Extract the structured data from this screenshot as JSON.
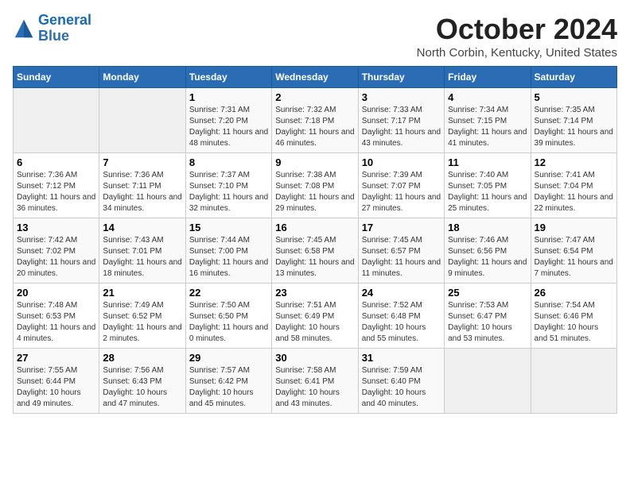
{
  "logo": {
    "line1": "General",
    "line2": "Blue"
  },
  "title": "October 2024",
  "subtitle": "North Corbin, Kentucky, United States",
  "days_header": [
    "Sunday",
    "Monday",
    "Tuesday",
    "Wednesday",
    "Thursday",
    "Friday",
    "Saturday"
  ],
  "weeks": [
    [
      {
        "day": "",
        "info": ""
      },
      {
        "day": "",
        "info": ""
      },
      {
        "day": "1",
        "info": "Sunrise: 7:31 AM\nSunset: 7:20 PM\nDaylight: 11 hours and 48 minutes."
      },
      {
        "day": "2",
        "info": "Sunrise: 7:32 AM\nSunset: 7:18 PM\nDaylight: 11 hours and 46 minutes."
      },
      {
        "day": "3",
        "info": "Sunrise: 7:33 AM\nSunset: 7:17 PM\nDaylight: 11 hours and 43 minutes."
      },
      {
        "day": "4",
        "info": "Sunrise: 7:34 AM\nSunset: 7:15 PM\nDaylight: 11 hours and 41 minutes."
      },
      {
        "day": "5",
        "info": "Sunrise: 7:35 AM\nSunset: 7:14 PM\nDaylight: 11 hours and 39 minutes."
      }
    ],
    [
      {
        "day": "6",
        "info": "Sunrise: 7:36 AM\nSunset: 7:12 PM\nDaylight: 11 hours and 36 minutes."
      },
      {
        "day": "7",
        "info": "Sunrise: 7:36 AM\nSunset: 7:11 PM\nDaylight: 11 hours and 34 minutes."
      },
      {
        "day": "8",
        "info": "Sunrise: 7:37 AM\nSunset: 7:10 PM\nDaylight: 11 hours and 32 minutes."
      },
      {
        "day": "9",
        "info": "Sunrise: 7:38 AM\nSunset: 7:08 PM\nDaylight: 11 hours and 29 minutes."
      },
      {
        "day": "10",
        "info": "Sunrise: 7:39 AM\nSunset: 7:07 PM\nDaylight: 11 hours and 27 minutes."
      },
      {
        "day": "11",
        "info": "Sunrise: 7:40 AM\nSunset: 7:05 PM\nDaylight: 11 hours and 25 minutes."
      },
      {
        "day": "12",
        "info": "Sunrise: 7:41 AM\nSunset: 7:04 PM\nDaylight: 11 hours and 22 minutes."
      }
    ],
    [
      {
        "day": "13",
        "info": "Sunrise: 7:42 AM\nSunset: 7:02 PM\nDaylight: 11 hours and 20 minutes."
      },
      {
        "day": "14",
        "info": "Sunrise: 7:43 AM\nSunset: 7:01 PM\nDaylight: 11 hours and 18 minutes."
      },
      {
        "day": "15",
        "info": "Sunrise: 7:44 AM\nSunset: 7:00 PM\nDaylight: 11 hours and 16 minutes."
      },
      {
        "day": "16",
        "info": "Sunrise: 7:45 AM\nSunset: 6:58 PM\nDaylight: 11 hours and 13 minutes."
      },
      {
        "day": "17",
        "info": "Sunrise: 7:45 AM\nSunset: 6:57 PM\nDaylight: 11 hours and 11 minutes."
      },
      {
        "day": "18",
        "info": "Sunrise: 7:46 AM\nSunset: 6:56 PM\nDaylight: 11 hours and 9 minutes."
      },
      {
        "day": "19",
        "info": "Sunrise: 7:47 AM\nSunset: 6:54 PM\nDaylight: 11 hours and 7 minutes."
      }
    ],
    [
      {
        "day": "20",
        "info": "Sunrise: 7:48 AM\nSunset: 6:53 PM\nDaylight: 11 hours and 4 minutes."
      },
      {
        "day": "21",
        "info": "Sunrise: 7:49 AM\nSunset: 6:52 PM\nDaylight: 11 hours and 2 minutes."
      },
      {
        "day": "22",
        "info": "Sunrise: 7:50 AM\nSunset: 6:50 PM\nDaylight: 11 hours and 0 minutes."
      },
      {
        "day": "23",
        "info": "Sunrise: 7:51 AM\nSunset: 6:49 PM\nDaylight: 10 hours and 58 minutes."
      },
      {
        "day": "24",
        "info": "Sunrise: 7:52 AM\nSunset: 6:48 PM\nDaylight: 10 hours and 55 minutes."
      },
      {
        "day": "25",
        "info": "Sunrise: 7:53 AM\nSunset: 6:47 PM\nDaylight: 10 hours and 53 minutes."
      },
      {
        "day": "26",
        "info": "Sunrise: 7:54 AM\nSunset: 6:46 PM\nDaylight: 10 hours and 51 minutes."
      }
    ],
    [
      {
        "day": "27",
        "info": "Sunrise: 7:55 AM\nSunset: 6:44 PM\nDaylight: 10 hours and 49 minutes."
      },
      {
        "day": "28",
        "info": "Sunrise: 7:56 AM\nSunset: 6:43 PM\nDaylight: 10 hours and 47 minutes."
      },
      {
        "day": "29",
        "info": "Sunrise: 7:57 AM\nSunset: 6:42 PM\nDaylight: 10 hours and 45 minutes."
      },
      {
        "day": "30",
        "info": "Sunrise: 7:58 AM\nSunset: 6:41 PM\nDaylight: 10 hours and 43 minutes."
      },
      {
        "day": "31",
        "info": "Sunrise: 7:59 AM\nSunset: 6:40 PM\nDaylight: 10 hours and 40 minutes."
      },
      {
        "day": "",
        "info": ""
      },
      {
        "day": "",
        "info": ""
      }
    ]
  ]
}
